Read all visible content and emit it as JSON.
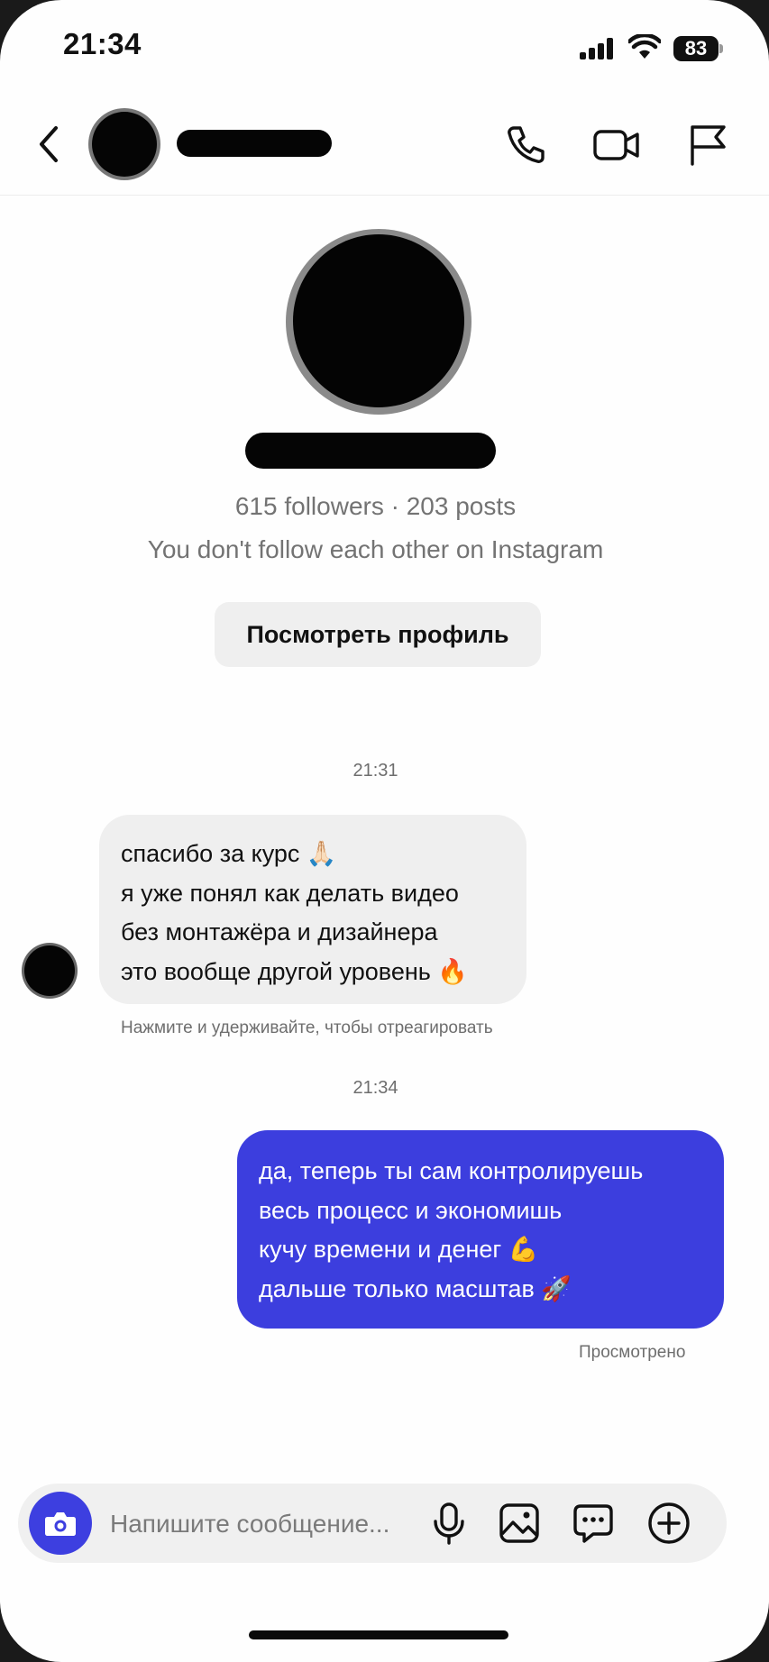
{
  "status_bar": {
    "time": "21:34",
    "battery": "83"
  },
  "header": {
    "icons": [
      "back-chevron-icon",
      "phone-icon",
      "video-camera-icon",
      "flag-icon"
    ]
  },
  "profile": {
    "stats": "615 followers · 203 posts",
    "follow_note": "You don't follow each other on Instagram",
    "view_profile_label": "Посмотреть профиль"
  },
  "conversation": {
    "timestamp_1": "21:31",
    "incoming": {
      "line_1": "спасибо за курс 🙏🏻",
      "line_2": "я уже понял как делать видео",
      "line_3": "без монтажёра и дизайнера",
      "line_4": "это вообще другой уровень 🔥"
    },
    "react_hint": "Нажмите и удерживайте, чтобы отреагировать",
    "timestamp_2": "21:34",
    "outgoing": {
      "line_1": "да, теперь ты сам контролируешь",
      "line_2": "весь процесс и экономишь",
      "line_3": "кучу времени и денег 💪",
      "line_4": "дальше только масштав 🚀"
    },
    "seen_label": "Просмотрено"
  },
  "composer": {
    "placeholder": "Напишите сообщение...",
    "icons": [
      "camera-icon",
      "microphone-icon",
      "gallery-icon",
      "sticker-icon",
      "plus-icon"
    ]
  },
  "colors": {
    "accent": "#3c3ede",
    "incoming_bubble": "#efefef",
    "muted_text": "#737373"
  }
}
